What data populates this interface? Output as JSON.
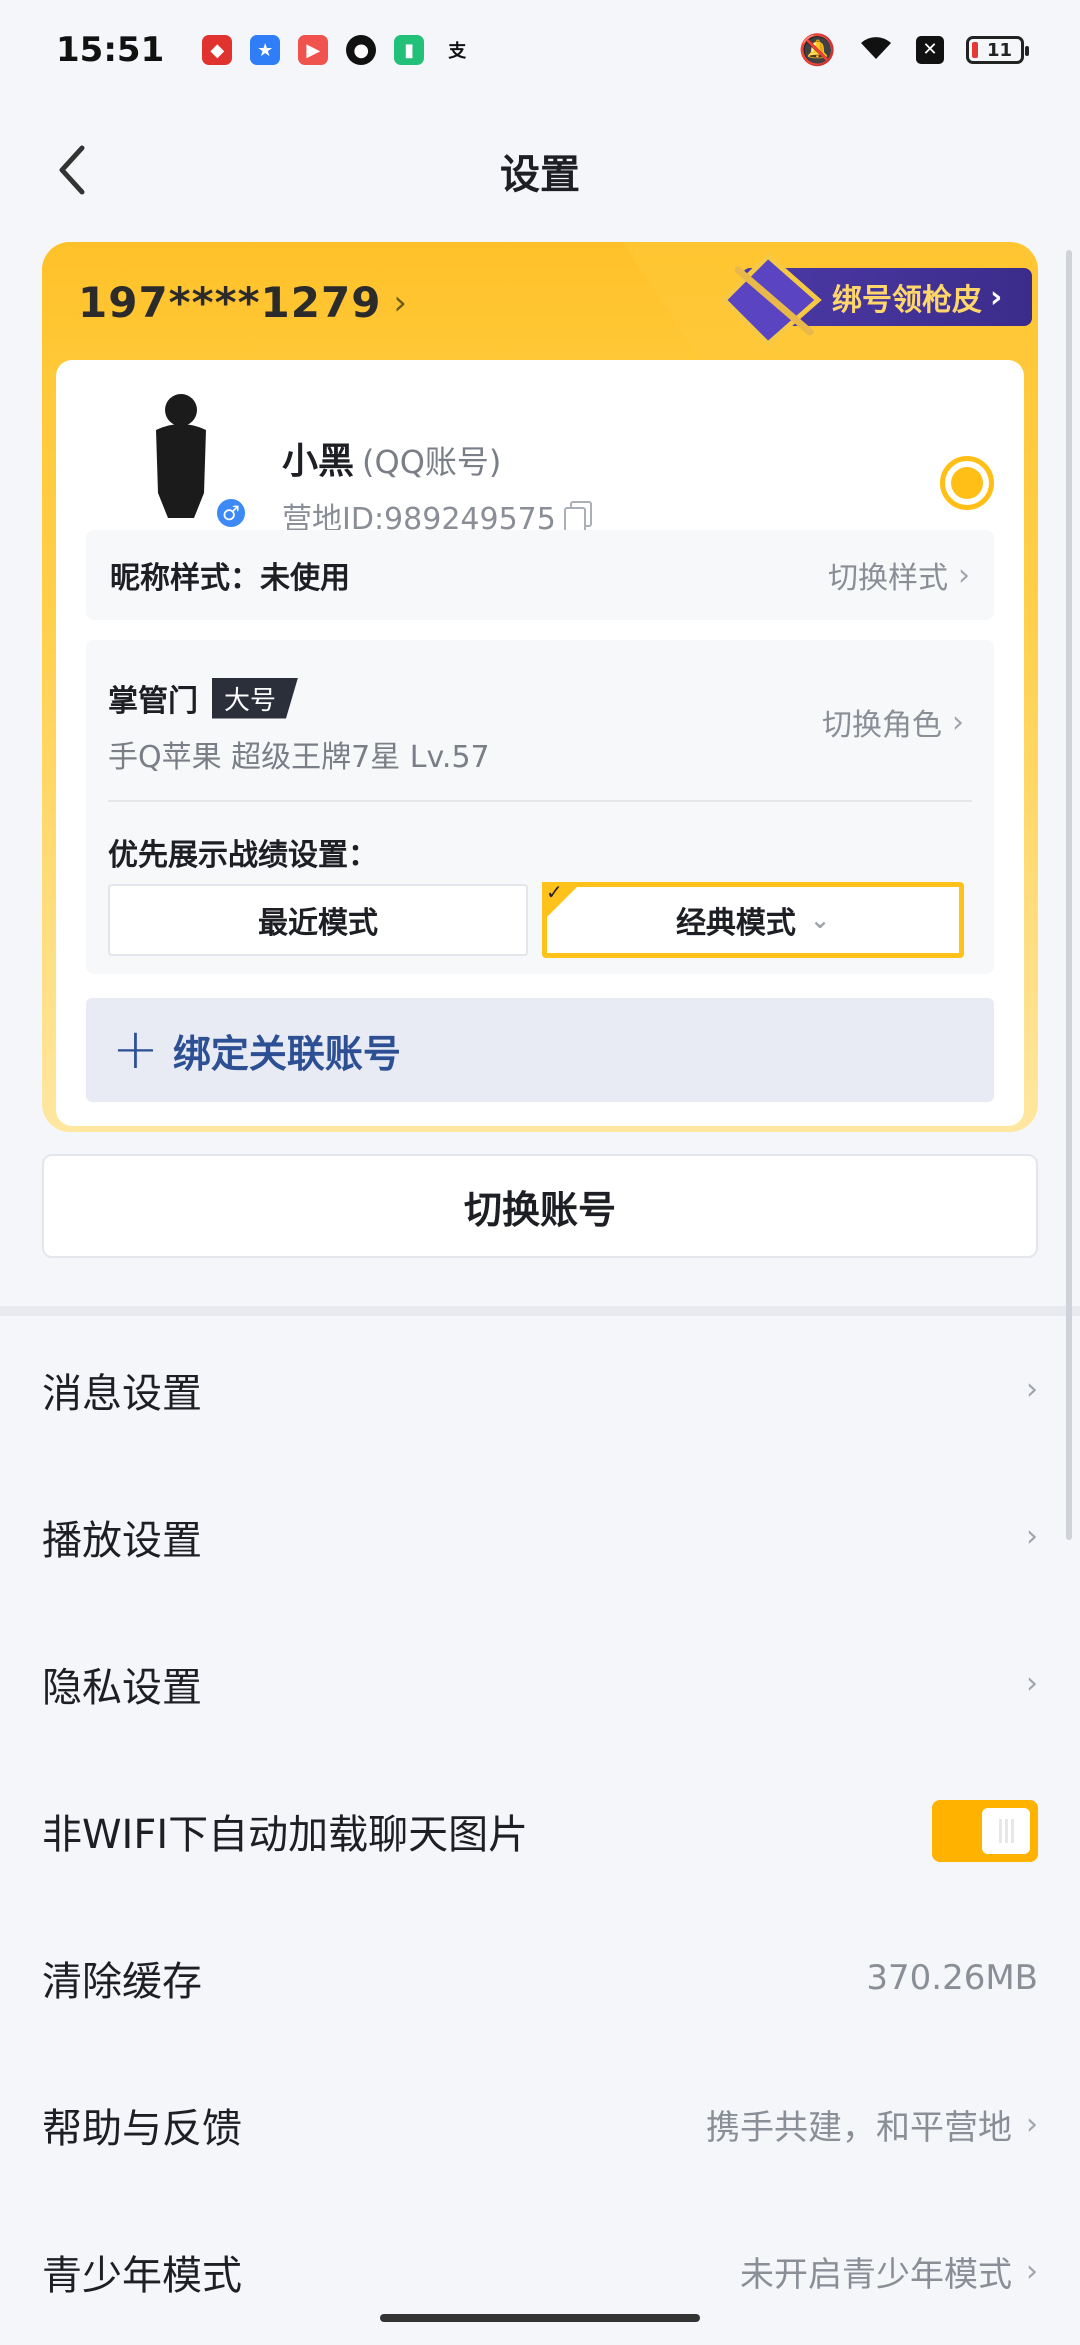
{
  "status_bar": {
    "time": "15:51",
    "notification_icons": [
      "app-shield-icon",
      "app-star-icon",
      "video-icon",
      "wechat-icon",
      "battery-app-icon",
      "alipay-icon"
    ],
    "battery_level": "11"
  },
  "header": {
    "title": "设置"
  },
  "account_card": {
    "phone": "197****1279",
    "promo": "绑号领枪皮",
    "nickname": "小黑",
    "account_type": "(QQ账号)",
    "camp_id": "营地ID:989249575",
    "nick_style_label": "昵称样式：未使用",
    "nick_style_action": "切换样式",
    "role_name": "掌管门",
    "role_tag": "大号",
    "role_info": "手Q苹果  超级王牌7星  Lv.57",
    "switch_role": "切换角色",
    "record_setting_label": "优先展示战绩设置：",
    "mode_recent": "最近模式",
    "mode_classic": "经典模式",
    "bind_label": "绑定关联账号"
  },
  "switch_account": "切换账号",
  "settings": [
    {
      "label": "消息设置",
      "value": ""
    },
    {
      "label": "播放设置",
      "value": ""
    },
    {
      "label": "隐私设置",
      "value": ""
    },
    {
      "label": "非WIFI下自动加载聊天图片",
      "toggle": true
    },
    {
      "label": "清除缓存",
      "value": "370.26MB"
    },
    {
      "label": "帮助与反馈",
      "value": "携手共建，和平营地"
    },
    {
      "label": "青少年模式",
      "value": "未开启青少年模式"
    }
  ],
  "colors": {
    "accent_yellow": "#ffc21a",
    "bind_blue": "#2d4f94",
    "toggle_on": "#ffb300"
  }
}
